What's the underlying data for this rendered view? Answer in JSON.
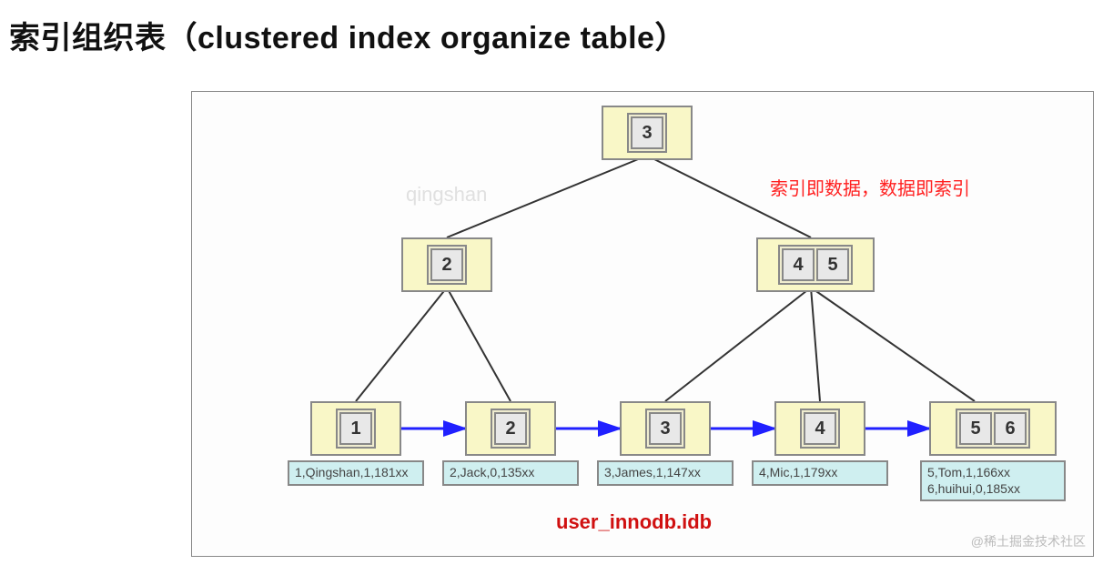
{
  "title": "索引组织表（clustered index organize table）",
  "note": "索引即数据，数据即索引",
  "watermark": "qingshan",
  "filename": "user_innodb.idb",
  "attribution": "@稀土掘金技术社区",
  "tree": {
    "root": {
      "keys": [
        "3"
      ]
    },
    "level2": [
      {
        "keys": [
          "2"
        ]
      },
      {
        "keys": [
          "4",
          "5"
        ]
      }
    ],
    "leaves": [
      {
        "keys": [
          "1"
        ],
        "data": "1,Qingshan,1,181xx"
      },
      {
        "keys": [
          "2"
        ],
        "data": "2,Jack,0,135xx"
      },
      {
        "keys": [
          "3"
        ],
        "data": "3,James,1,147xx"
      },
      {
        "keys": [
          "4"
        ],
        "data": "4,Mic,1,179xx"
      },
      {
        "keys": [
          "5",
          "6"
        ],
        "data": "5,Tom,1,166xx\n6,huihui,0,185xx"
      }
    ]
  }
}
